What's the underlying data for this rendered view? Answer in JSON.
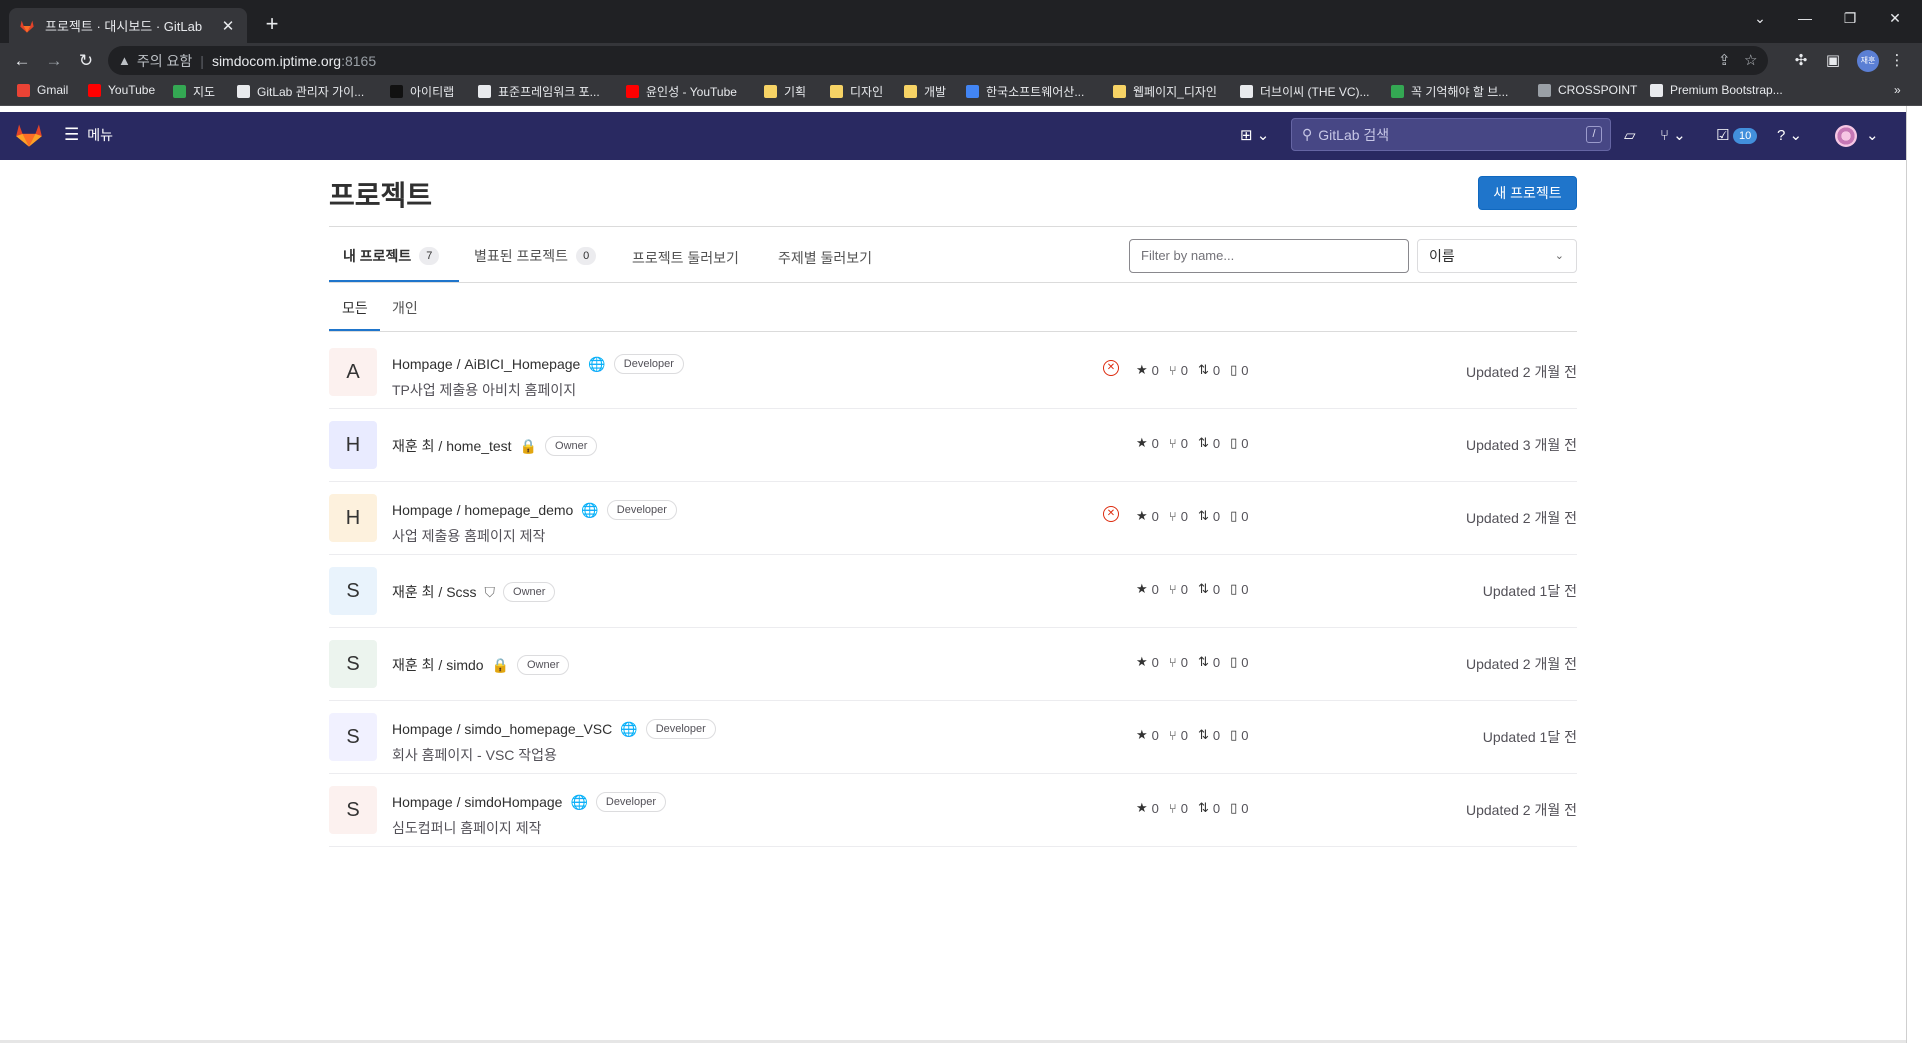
{
  "browser": {
    "tab_title": "프로젝트 · 대시보드 · GitLab",
    "tab_close": "✕",
    "new_tab": "+",
    "address": {
      "warning": "주의 요함",
      "host": "simdocom.iptime.org",
      "port": ":8165"
    },
    "profile_label": "재훈",
    "bookmarks": [
      {
        "label": "Gmail",
        "color": "#ea4335"
      },
      {
        "label": "YouTube",
        "color": "#ff0000"
      },
      {
        "label": "지도",
        "color": "#34a853"
      },
      {
        "label": "GitLab 관리자 가이...",
        "color": "#e8eaed"
      },
      {
        "label": "아이티랩",
        "color": "#111111"
      },
      {
        "label": "표준프레임워크 포...",
        "color": "#e8eaed"
      },
      {
        "label": "윤인성 - YouTube",
        "color": "#ff0000"
      },
      {
        "label": "기획",
        "color": "#f6d365"
      },
      {
        "label": "디자인",
        "color": "#f6d365"
      },
      {
        "label": "개발",
        "color": "#f6d365"
      },
      {
        "label": "한국소프트웨어산...",
        "color": "#4285f4"
      },
      {
        "label": "웹페이지_디자인",
        "color": "#f6d365"
      },
      {
        "label": "더브이씨 (THE VC)...",
        "color": "#e8eaed"
      },
      {
        "label": "꼭 기억해야 할 브...",
        "color": "#34a853"
      },
      {
        "label": "CROSSPOINT",
        "color": "#9aa0a6"
      },
      {
        "label": "Premium Bootstrap...",
        "color": "#e8eaed"
      }
    ],
    "bookmarks_more": "»"
  },
  "gitlab": {
    "menu_label": "메뉴",
    "search_placeholder": "GitLab 검색",
    "search_shortcut": "/",
    "todo_count": "10",
    "brand_color": "#292961"
  },
  "page": {
    "title": "프로젝트",
    "new_project_button": "새 프로젝트",
    "tabs": [
      {
        "label": "내 프로젝트",
        "count": "7"
      },
      {
        "label": "별표된 프로젝트",
        "count": "0"
      },
      {
        "label": "프로젝트 둘러보기"
      },
      {
        "label": "주제별 둘러보기"
      }
    ],
    "filter_placeholder": "Filter by name...",
    "sort_value": "이름",
    "subtabs": [
      "모든",
      "개인"
    ]
  },
  "projects": [
    {
      "avatar": "A",
      "avatar_bg": "#fcf1ef",
      "namespace": "Hompage / ",
      "name": "AiBICI_Homepage",
      "visibility": "globe-icon",
      "role": "Developer",
      "desc": "TP사업 제출용 아비치 홈페이지",
      "pipeline_failed": true,
      "stars": "0",
      "forks": "0",
      "mrs": "0",
      "issues": "0",
      "updated": "Updated 2 개월 전"
    },
    {
      "avatar": "H",
      "avatar_bg": "#e9ebff",
      "namespace": "재훈 최 / ",
      "name": "home_test",
      "visibility": "lock-icon",
      "role": "Owner",
      "desc": "",
      "pipeline_failed": false,
      "stars": "0",
      "forks": "0",
      "mrs": "0",
      "issues": "0",
      "updated": "Updated 3 개월 전"
    },
    {
      "avatar": "H",
      "avatar_bg": "#fdf1dd",
      "namespace": "Hompage / ",
      "name": "homepage_demo",
      "visibility": "globe-icon",
      "role": "Developer",
      "desc": "사업 제출용 홈페이지 제작",
      "pipeline_failed": true,
      "stars": "0",
      "forks": "0",
      "mrs": "0",
      "issues": "0",
      "updated": "Updated 2 개월 전"
    },
    {
      "avatar": "S",
      "avatar_bg": "#e9f3fc",
      "namespace": "재훈 최 / ",
      "name": "Scss",
      "visibility": "shield-icon",
      "role": "Owner",
      "desc": "",
      "pipeline_failed": false,
      "stars": "0",
      "forks": "0",
      "mrs": "0",
      "issues": "0",
      "updated": "Updated 1달 전"
    },
    {
      "avatar": "S",
      "avatar_bg": "#ecf4ee",
      "namespace": "재훈 최 / ",
      "name": "simdo",
      "visibility": "lock-icon",
      "role": "Owner",
      "desc": "",
      "pipeline_failed": false,
      "stars": "0",
      "forks": "0",
      "mrs": "0",
      "issues": "0",
      "updated": "Updated 2 개월 전"
    },
    {
      "avatar": "S",
      "avatar_bg": "#f1f1ff",
      "namespace": "Hompage / ",
      "name": "simdo_homepage_VSC",
      "visibility": "globe-icon",
      "role": "Developer",
      "desc": "회사 홈페이지 - VSC 작업용",
      "pipeline_failed": false,
      "stars": "0",
      "forks": "0",
      "mrs": "0",
      "issues": "0",
      "updated": "Updated 1달 전"
    },
    {
      "avatar": "S",
      "avatar_bg": "#fcf1ef",
      "namespace": "Hompage / ",
      "name": "simdoHompage",
      "visibility": "globe-icon",
      "role": "Developer",
      "desc": "심도컴퍼니 홈페이지 제작",
      "pipeline_failed": false,
      "stars": "0",
      "forks": "0",
      "mrs": "0",
      "issues": "0",
      "updated": "Updated 2 개월 전"
    }
  ]
}
